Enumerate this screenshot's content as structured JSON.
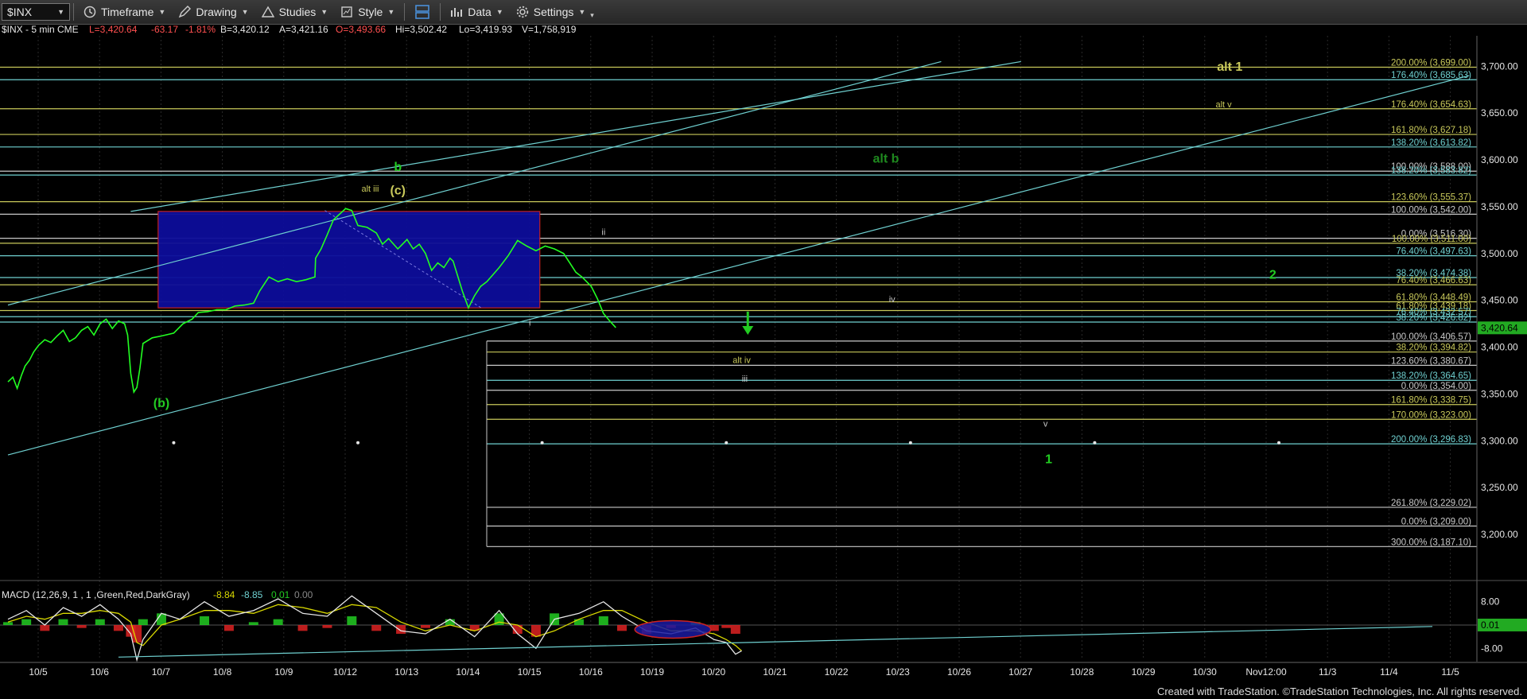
{
  "toolbar": {
    "symbol": "$INX",
    "timeframe": "Timeframe",
    "drawing": "Drawing",
    "studies": "Studies",
    "style": "Style",
    "data": "Data",
    "settings": "Settings"
  },
  "header": {
    "symbol_info": "$INX - 5 min  CME",
    "last": "L=3,420.64",
    "change": "-63.17",
    "change_pct": "-1.81%",
    "bid": "B=3,420.12",
    "ask": "A=3,421.16",
    "open": "O=3,493.66",
    "high": "Hi=3,502.42",
    "low": "Lo=3,419.93",
    "volume": "V=1,758,919"
  },
  "footer": "Created with TradeStation. ©TradeStation Technologies, Inc. All rights reserved.",
  "colors": {
    "background": "#000000",
    "price": "#22ff22",
    "fib_yellow": "#c8c85a",
    "fib_cyan": "#6fd0d0",
    "fib_white": "#c8c8c8",
    "label_green": "#22cc22",
    "label_yellow": "#d8d800",
    "box": "#0d0d9a",
    "box_border": "#cc2222"
  },
  "chart_data": {
    "type": "line",
    "title": "$INX - 5 min CME",
    "ylim": [
      3150,
      3730
    ],
    "y_ticks": [
      3200,
      3250,
      3300,
      3350,
      3400,
      3450,
      3500,
      3550,
      3600,
      3650,
      3700
    ],
    "y_tick_labels": [
      "3,200.00",
      "3,250.00",
      "3,300.00",
      "3,350.00",
      "3,400.00",
      "3,450.00",
      "3,500.00",
      "3,550.00",
      "3,600.00",
      "3,650.00",
      "3,700.00"
    ],
    "last_price_label": "3,420.64",
    "x_categories": [
      "10/5",
      "10/6",
      "10/7",
      "10/8",
      "10/9",
      "10/12",
      "10/13",
      "10/14",
      "10/15",
      "10/16",
      "10/19",
      "10/20",
      "10/21",
      "10/22",
      "10/23",
      "10/26",
      "10/27",
      "10/28",
      "10/29",
      "10/30",
      "Nov12:00",
      "11/3",
      "11/4",
      "11/5"
    ],
    "price_path": [
      [
        0.0,
        3363
      ],
      [
        0.08,
        3368
      ],
      [
        0.15,
        3356
      ],
      [
        0.22,
        3370
      ],
      [
        0.28,
        3380
      ],
      [
        0.35,
        3386
      ],
      [
        0.42,
        3395
      ],
      [
        0.5,
        3402
      ],
      [
        0.6,
        3408
      ],
      [
        0.7,
        3405
      ],
      [
        0.8,
        3412
      ],
      [
        0.9,
        3418
      ],
      [
        1.0,
        3406
      ],
      [
        1.1,
        3410
      ],
      [
        1.2,
        3418
      ],
      [
        1.3,
        3422
      ],
      [
        1.4,
        3413
      ],
      [
        1.5,
        3425
      ],
      [
        1.6,
        3430
      ],
      [
        1.7,
        3420
      ],
      [
        1.8,
        3428
      ],
      [
        1.9,
        3425
      ],
      [
        1.95,
        3413
      ],
      [
        2.0,
        3372
      ],
      [
        2.05,
        3352
      ],
      [
        2.1,
        3357
      ],
      [
        2.15,
        3378
      ],
      [
        2.2,
        3404
      ],
      [
        2.35,
        3410
      ],
      [
        2.5,
        3412
      ],
      [
        2.7,
        3415
      ],
      [
        2.85,
        3425
      ],
      [
        3.0,
        3430
      ],
      [
        3.1,
        3437
      ],
      [
        3.25,
        3438
      ],
      [
        3.4,
        3440
      ],
      [
        3.55,
        3440
      ],
      [
        3.7,
        3444
      ],
      [
        3.85,
        3445
      ],
      [
        4.0,
        3447
      ],
      [
        4.1,
        3460
      ],
      [
        4.25,
        3475
      ],
      [
        4.4,
        3470
      ],
      [
        4.55,
        3473
      ],
      [
        4.7,
        3470
      ],
      [
        4.85,
        3472
      ],
      [
        5.0,
        3475
      ],
      [
        5.01,
        3495
      ],
      [
        5.1,
        3505
      ],
      [
        5.2,
        3520
      ],
      [
        5.3,
        3536
      ],
      [
        5.4,
        3542
      ],
      [
        5.5,
        3548
      ],
      [
        5.6,
        3546
      ],
      [
        5.7,
        3530
      ],
      [
        5.85,
        3528
      ],
      [
        6.0,
        3522
      ],
      [
        6.1,
        3510
      ],
      [
        6.2,
        3516
      ],
      [
        6.35,
        3505
      ],
      [
        6.5,
        3515
      ],
      [
        6.6,
        3505
      ],
      [
        6.7,
        3510
      ],
      [
        6.8,
        3500
      ],
      [
        6.9,
        3482
      ],
      [
        7.0,
        3490
      ],
      [
        7.1,
        3485
      ],
      [
        7.2,
        3495
      ],
      [
        7.25,
        3492
      ],
      [
        7.4,
        3460
      ],
      [
        7.5,
        3442
      ],
      [
        7.6,
        3455
      ],
      [
        7.7,
        3465
      ],
      [
        7.8,
        3470
      ],
      [
        8.0,
        3485
      ],
      [
        8.15,
        3498
      ],
      [
        8.3,
        3514
      ],
      [
        8.45,
        3508
      ],
      [
        8.6,
        3503
      ],
      [
        8.75,
        3508
      ],
      [
        8.9,
        3505
      ],
      [
        9.05,
        3500
      ],
      [
        9.15,
        3490
      ],
      [
        9.25,
        3480
      ],
      [
        9.35,
        3475
      ],
      [
        9.5,
        3465
      ],
      [
        9.6,
        3452
      ],
      [
        9.7,
        3436
      ],
      [
        9.8,
        3428
      ],
      [
        9.9,
        3421
      ]
    ],
    "fib_levels": [
      {
        "label": "200.00% (3,699.00)",
        "value": 3699.0,
        "color": "yellow"
      },
      {
        "label": "176.40% (3,685.63)",
        "value": 3685.63,
        "color": "cyan"
      },
      {
        "label": "176.40% (3,654.63)",
        "value": 3654.63,
        "color": "yellow"
      },
      {
        "label": "161.80% (3,627.18)",
        "value": 3627.18,
        "color": "yellow"
      },
      {
        "label": "138.20% (3,613.82)",
        "value": 3613.82,
        "color": "cyan"
      },
      {
        "label": "100.00% (3,588.00)",
        "value": 3588.0,
        "color": "white"
      },
      {
        "label": "138.20% (3,583.82)",
        "value": 3583.82,
        "color": "cyan"
      },
      {
        "label": "123.60% (3,555.37)",
        "value": 3555.37,
        "color": "yellow"
      },
      {
        "label": "100.00% (3,542.00)",
        "value": 3542.0,
        "color": "white"
      },
      {
        "label": "0.00% (3,516.30)",
        "value": 3516.3,
        "color": "white"
      },
      {
        "label": "100.00% (3,511.00)",
        "value": 3511.0,
        "color": "yellow"
      },
      {
        "label": "76.40% (3,497.63)",
        "value": 3497.63,
        "color": "cyan"
      },
      {
        "label": "38.20% (3,474.38)",
        "value": 3474.38,
        "color": "cyan"
      },
      {
        "label": "76.40% (3,466.63)",
        "value": 3466.63,
        "color": "yellow"
      },
      {
        "label": "61.80% (3,448.49)",
        "value": 3448.49,
        "color": "yellow"
      },
      {
        "label": "61.80% (3,439.18)",
        "value": 3439.18,
        "color": "yellow"
      },
      {
        "label": "76.40% (3,432.57)",
        "value": 3432.57,
        "color": "cyan"
      },
      {
        "label": "38.20% (3,426.82)",
        "value": 3426.82,
        "color": "cyan"
      },
      {
        "label": "100.00% (3,406.57)",
        "value": 3406.57,
        "color": "white"
      },
      {
        "label": "38.20% (3,394.82)",
        "value": 3394.82,
        "color": "yellow"
      },
      {
        "label": "123.60% (3,380.67)",
        "value": 3380.67,
        "color": "white"
      },
      {
        "label": "138.20% (3,364.65)",
        "value": 3364.65,
        "color": "cyan"
      },
      {
        "label": "0.00% (3,354.00)",
        "value": 3354.0,
        "color": "white"
      },
      {
        "label": "161.80% (3,338.75)",
        "value": 3338.75,
        "color": "yellow"
      },
      {
        "label": "170.00% (3,323.00)",
        "value": 3323.0,
        "color": "yellow"
      },
      {
        "label": "200.00% (3,296.83)",
        "value": 3296.83,
        "color": "cyan"
      },
      {
        "label": "261.80% (3,229.02)",
        "value": 3229.02,
        "color": "white"
      },
      {
        "label": "0.00% (3,209.00)",
        "value": 3209.0,
        "color": "white"
      },
      {
        "label": "300.00% (3,187.10)",
        "value": 3187.1,
        "color": "white"
      }
    ],
    "trend_lines": [
      {
        "from": [
          0.0,
          3445
        ],
        "to": [
          15.2,
          3705
        ],
        "color": "cyan"
      },
      {
        "from": [
          0.0,
          3285
        ],
        "to": [
          23.8,
          3690
        ],
        "color": "cyan"
      },
      {
        "from": [
          2.0,
          3545
        ],
        "to": [
          16.5,
          3705
        ],
        "color": "cyan"
      }
    ],
    "box": {
      "x0": 4.0,
      "x1": 8.3,
      "y0": 3442,
      "y1": 3545
    },
    "dotted_level": {
      "value": 3298,
      "x_points": [
        2.7,
        5.7,
        8.7,
        11.7,
        14.7,
        17.7,
        20.7
      ]
    },
    "wave_labels": [
      {
        "text": "b",
        "x": 6.35,
        "y": 3588,
        "color": "green"
      },
      {
        "text": "(c)",
        "x": 6.35,
        "y": 3563,
        "color": "yellow"
      },
      {
        "text": "alt iii",
        "x": 5.9,
        "y": 3566,
        "color": "yellow"
      },
      {
        "text": "(b)",
        "x": 2.5,
        "y": 3336,
        "color": "green"
      },
      {
        "text": "ii",
        "x": 9.7,
        "y": 3520,
        "color": "white"
      },
      {
        "text": "i",
        "x": 8.5,
        "y": 3423,
        "color": "white"
      },
      {
        "text": "alt b",
        "x": 14.3,
        "y": 3597,
        "color": "darkgreen"
      },
      {
        "text": "alt 1",
        "x": 19.9,
        "y": 3695,
        "color": "yellow"
      },
      {
        "text": "alt v",
        "x": 19.8,
        "y": 3656,
        "color": "yellow"
      },
      {
        "text": "2",
        "x": 20.6,
        "y": 3473,
        "color": "green"
      },
      {
        "text": "iv",
        "x": 14.4,
        "y": 3448,
        "color": "white"
      },
      {
        "text": "alt iv",
        "x": 11.95,
        "y": 3383,
        "color": "yellow"
      },
      {
        "text": "iii",
        "x": 12.0,
        "y": 3363,
        "color": "white"
      },
      {
        "text": "v",
        "x": 16.9,
        "y": 3315,
        "color": "white"
      },
      {
        "text": "1",
        "x": 16.95,
        "y": 3276,
        "color": "green"
      }
    ],
    "arrow": {
      "x": 12.05,
      "y_top": 3438,
      "y_bottom": 3415,
      "color": "green"
    },
    "macd": {
      "label": "MACD (12,26,9, 1 , 1 ,Green,Red,DarkGray)",
      "macd_value": "-8.84",
      "signal_value": "-8.85",
      "hist_value": "0.01",
      "zero_value": "0.00",
      "ylim": [
        -12,
        12
      ],
      "y_tick_labels": [
        "8.00",
        "0.01",
        "-8.00"
      ],
      "macd_line": [
        [
          0.0,
          2
        ],
        [
          0.3,
          5
        ],
        [
          0.6,
          0
        ],
        [
          0.9,
          6
        ],
        [
          1.2,
          3
        ],
        [
          1.5,
          7
        ],
        [
          1.8,
          2
        ],
        [
          2.0,
          -3
        ],
        [
          2.1,
          -12
        ],
        [
          2.2,
          -5
        ],
        [
          2.5,
          4
        ],
        [
          2.8,
          2
        ],
        [
          3.2,
          8
        ],
        [
          3.6,
          3
        ],
        [
          4.0,
          5
        ],
        [
          4.4,
          9
        ],
        [
          4.8,
          4
        ],
        [
          5.2,
          3
        ],
        [
          5.6,
          10
        ],
        [
          6.0,
          4
        ],
        [
          6.4,
          -2
        ],
        [
          6.8,
          -3
        ],
        [
          7.2,
          2
        ],
        [
          7.6,
          -4
        ],
        [
          8.0,
          5
        ],
        [
          8.3,
          -3
        ],
        [
          8.6,
          -8
        ],
        [
          8.9,
          2
        ],
        [
          9.3,
          4
        ],
        [
          9.7,
          8
        ],
        [
          10.0,
          3
        ],
        [
          10.4,
          -2
        ],
        [
          10.8,
          -3
        ],
        [
          11.2,
          -1
        ],
        [
          11.5,
          -5
        ],
        [
          11.7,
          -6
        ],
        [
          11.85,
          -10
        ],
        [
          11.95,
          -8.84
        ]
      ],
      "signal_line": [
        [
          0.0,
          1
        ],
        [
          0.3,
          3
        ],
        [
          0.6,
          2
        ],
        [
          0.9,
          4
        ],
        [
          1.2,
          4
        ],
        [
          1.5,
          5
        ],
        [
          1.8,
          4
        ],
        [
          2.0,
          1
        ],
        [
          2.1,
          -6
        ],
        [
          2.2,
          -7
        ],
        [
          2.5,
          0
        ],
        [
          2.8,
          2
        ],
        [
          3.2,
          5
        ],
        [
          3.6,
          5
        ],
        [
          4.0,
          4
        ],
        [
          4.4,
          7
        ],
        [
          4.8,
          6
        ],
        [
          5.2,
          4
        ],
        [
          5.6,
          7
        ],
        [
          6.0,
          6
        ],
        [
          6.4,
          1
        ],
        [
          6.8,
          -2
        ],
        [
          7.2,
          0
        ],
        [
          7.6,
          -2
        ],
        [
          8.0,
          1
        ],
        [
          8.3,
          0
        ],
        [
          8.6,
          -4
        ],
        [
          8.9,
          -2
        ],
        [
          9.3,
          2
        ],
        [
          9.7,
          5
        ],
        [
          10.0,
          5
        ],
        [
          10.4,
          1
        ],
        [
          10.8,
          -2
        ],
        [
          11.2,
          -2
        ],
        [
          11.5,
          -3
        ],
        [
          11.7,
          -5
        ],
        [
          11.85,
          -7
        ],
        [
          11.95,
          -8.85
        ]
      ],
      "trendline": {
        "from": [
          1.8,
          -11
        ],
        "to": [
          23.2,
          -0.5
        ]
      },
      "ellipse": {
        "cx": 10.83,
        "cy": -1.5,
        "rx": 0.62,
        "ry": 3.0
      }
    }
  }
}
